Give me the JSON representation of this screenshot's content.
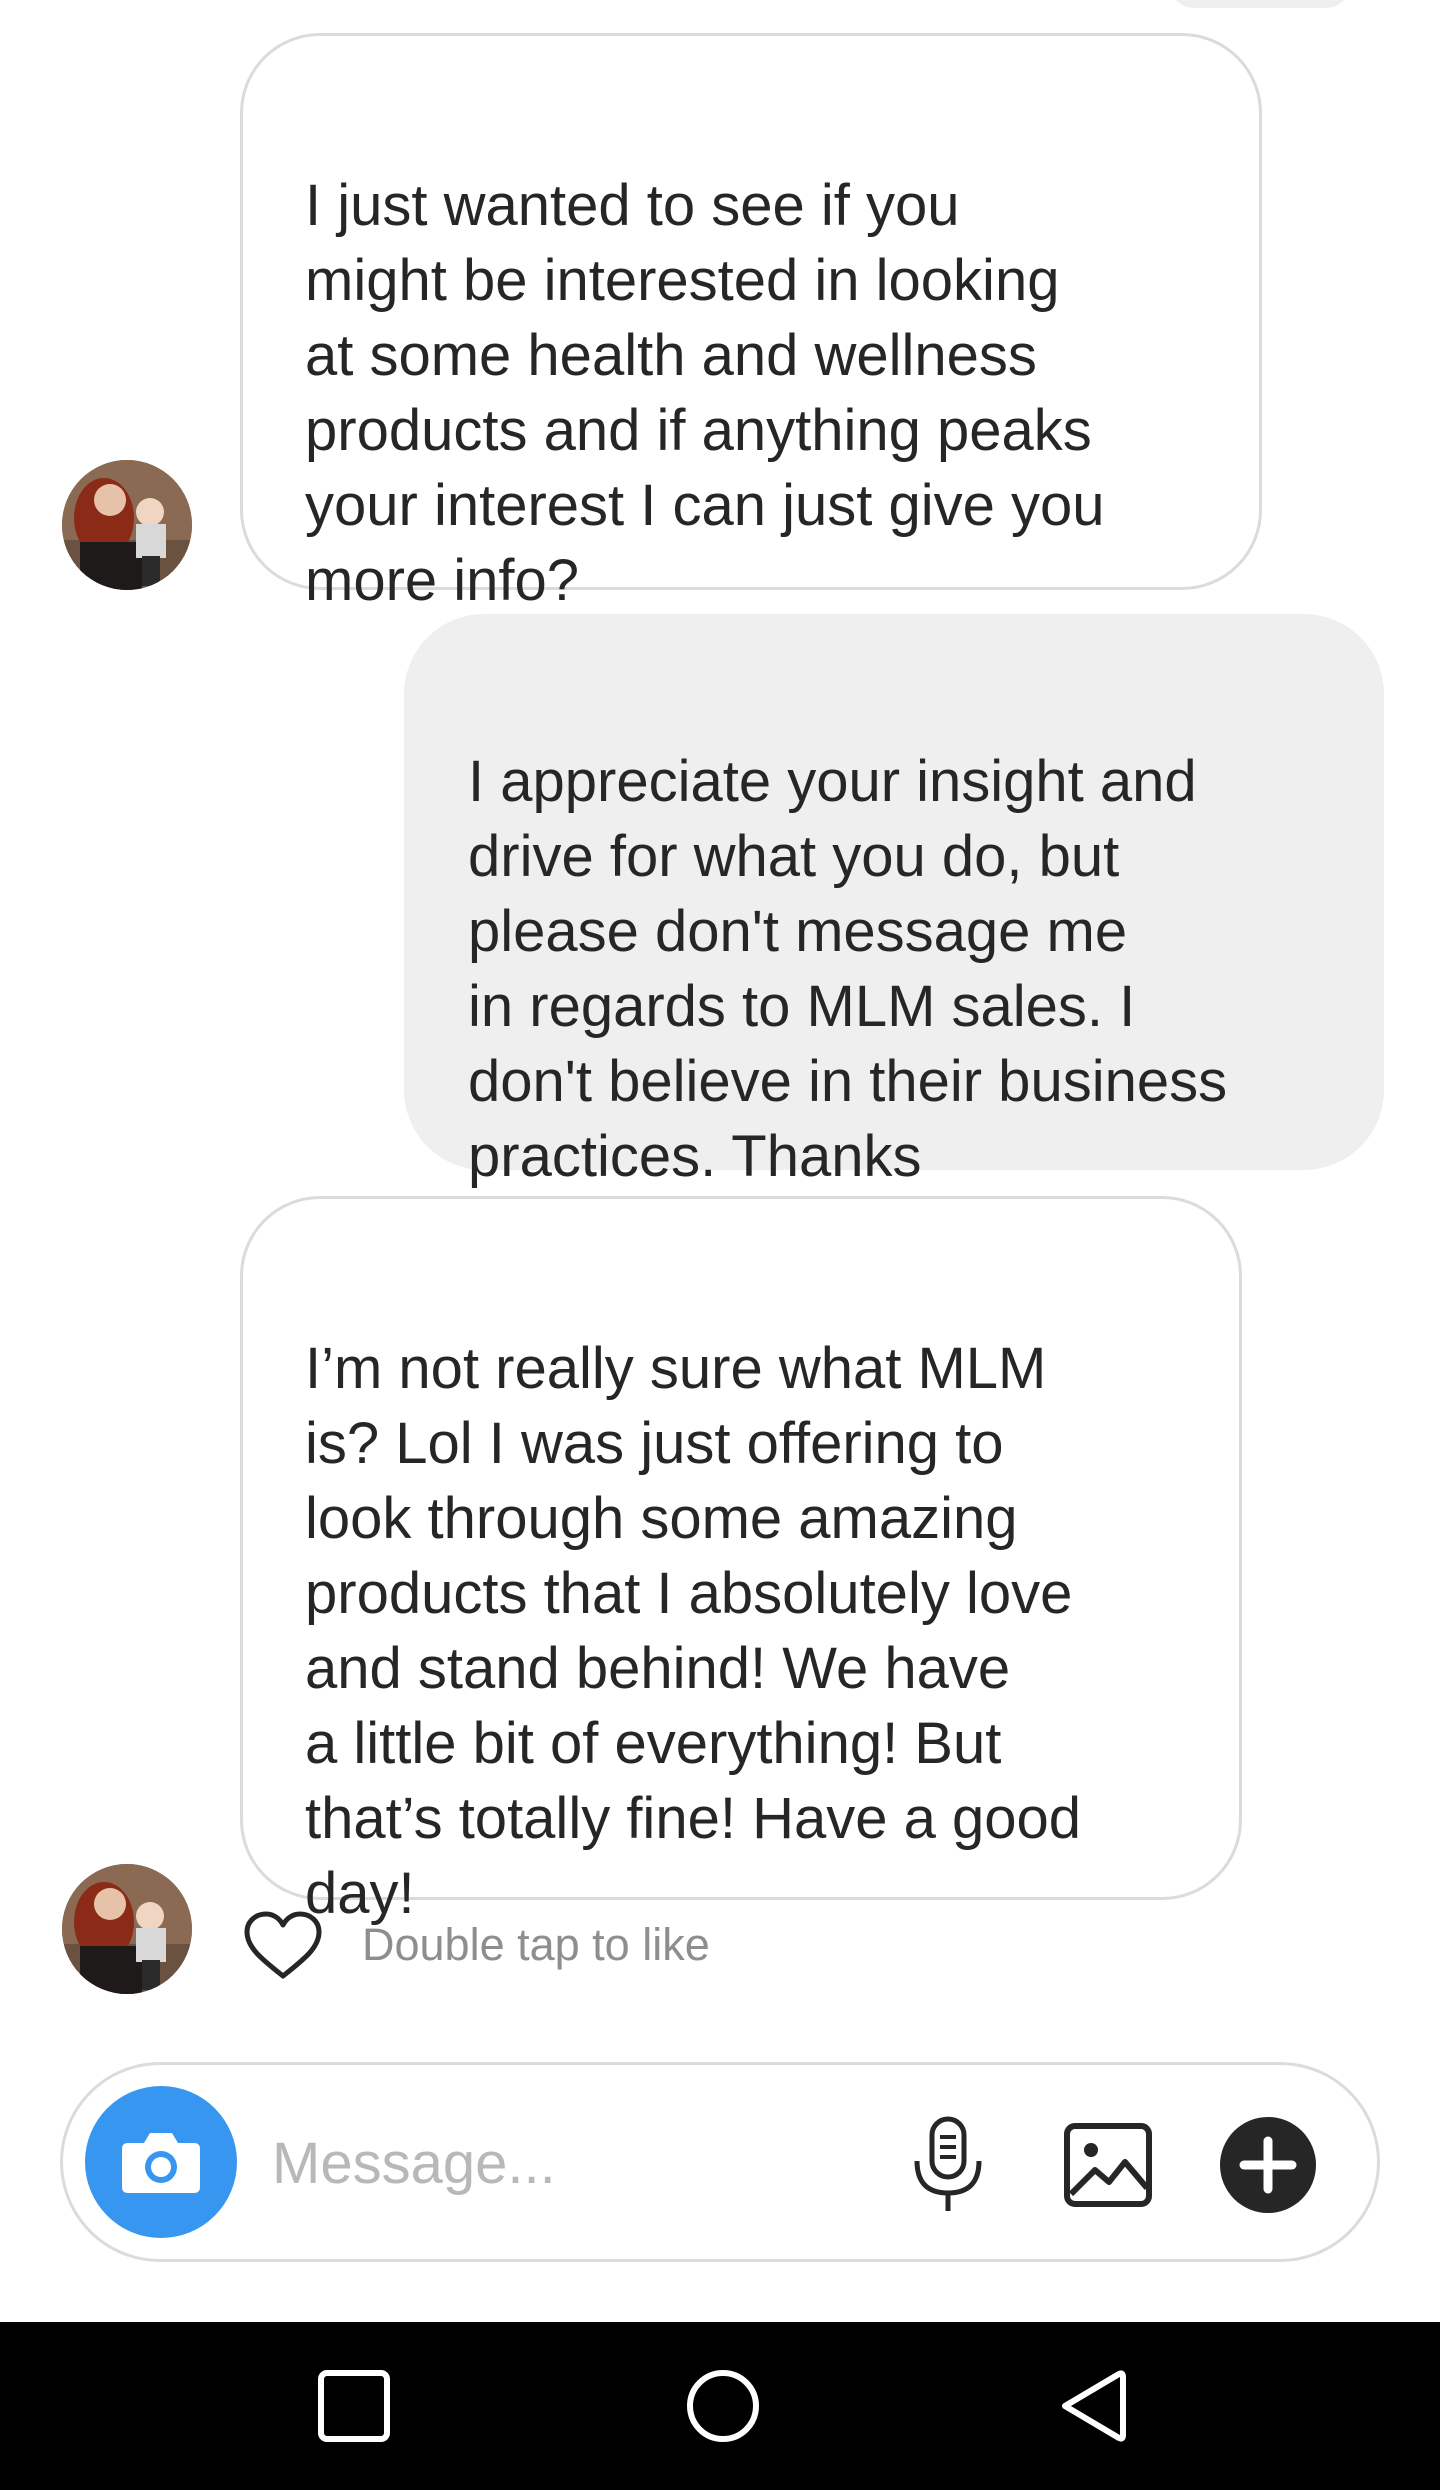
{
  "conversation": {
    "messages": [
      {
        "direction": "incoming",
        "text": "I just wanted to see if you\nmight be interested in looking\nat some health and wellness\nproducts and if anything peaks\nyour interest I can just give you\nmore info?"
      },
      {
        "direction": "outgoing",
        "text": "I appreciate your insight and\ndrive for what you do, but\nplease don't message me\nin regards to MLM sales. I\ndon't believe in their business\npractices. Thanks"
      },
      {
        "direction": "incoming",
        "text": "I’m not really sure what MLM\nis? Lol I was just offering to\nlook through some amazing\nproducts that I absolutely love\nand stand behind! We have\na little bit of everything! But\nthat’s totally fine! Have a good\nday!"
      }
    ],
    "like_hint": "Double tap to like"
  },
  "composer": {
    "placeholder": "Message...",
    "value": "",
    "icons": [
      "camera-icon",
      "microphone-icon",
      "gallery-icon",
      "plus-icon"
    ],
    "camera_color": "#3797f0"
  },
  "navigation_bar": {
    "icons": [
      "recents-icon",
      "home-icon",
      "back-icon"
    ]
  },
  "colors": {
    "incoming_border": "#dbdbdb",
    "outgoing_background": "#efefef",
    "text": "#262626",
    "hint": "#8e8e8e"
  }
}
